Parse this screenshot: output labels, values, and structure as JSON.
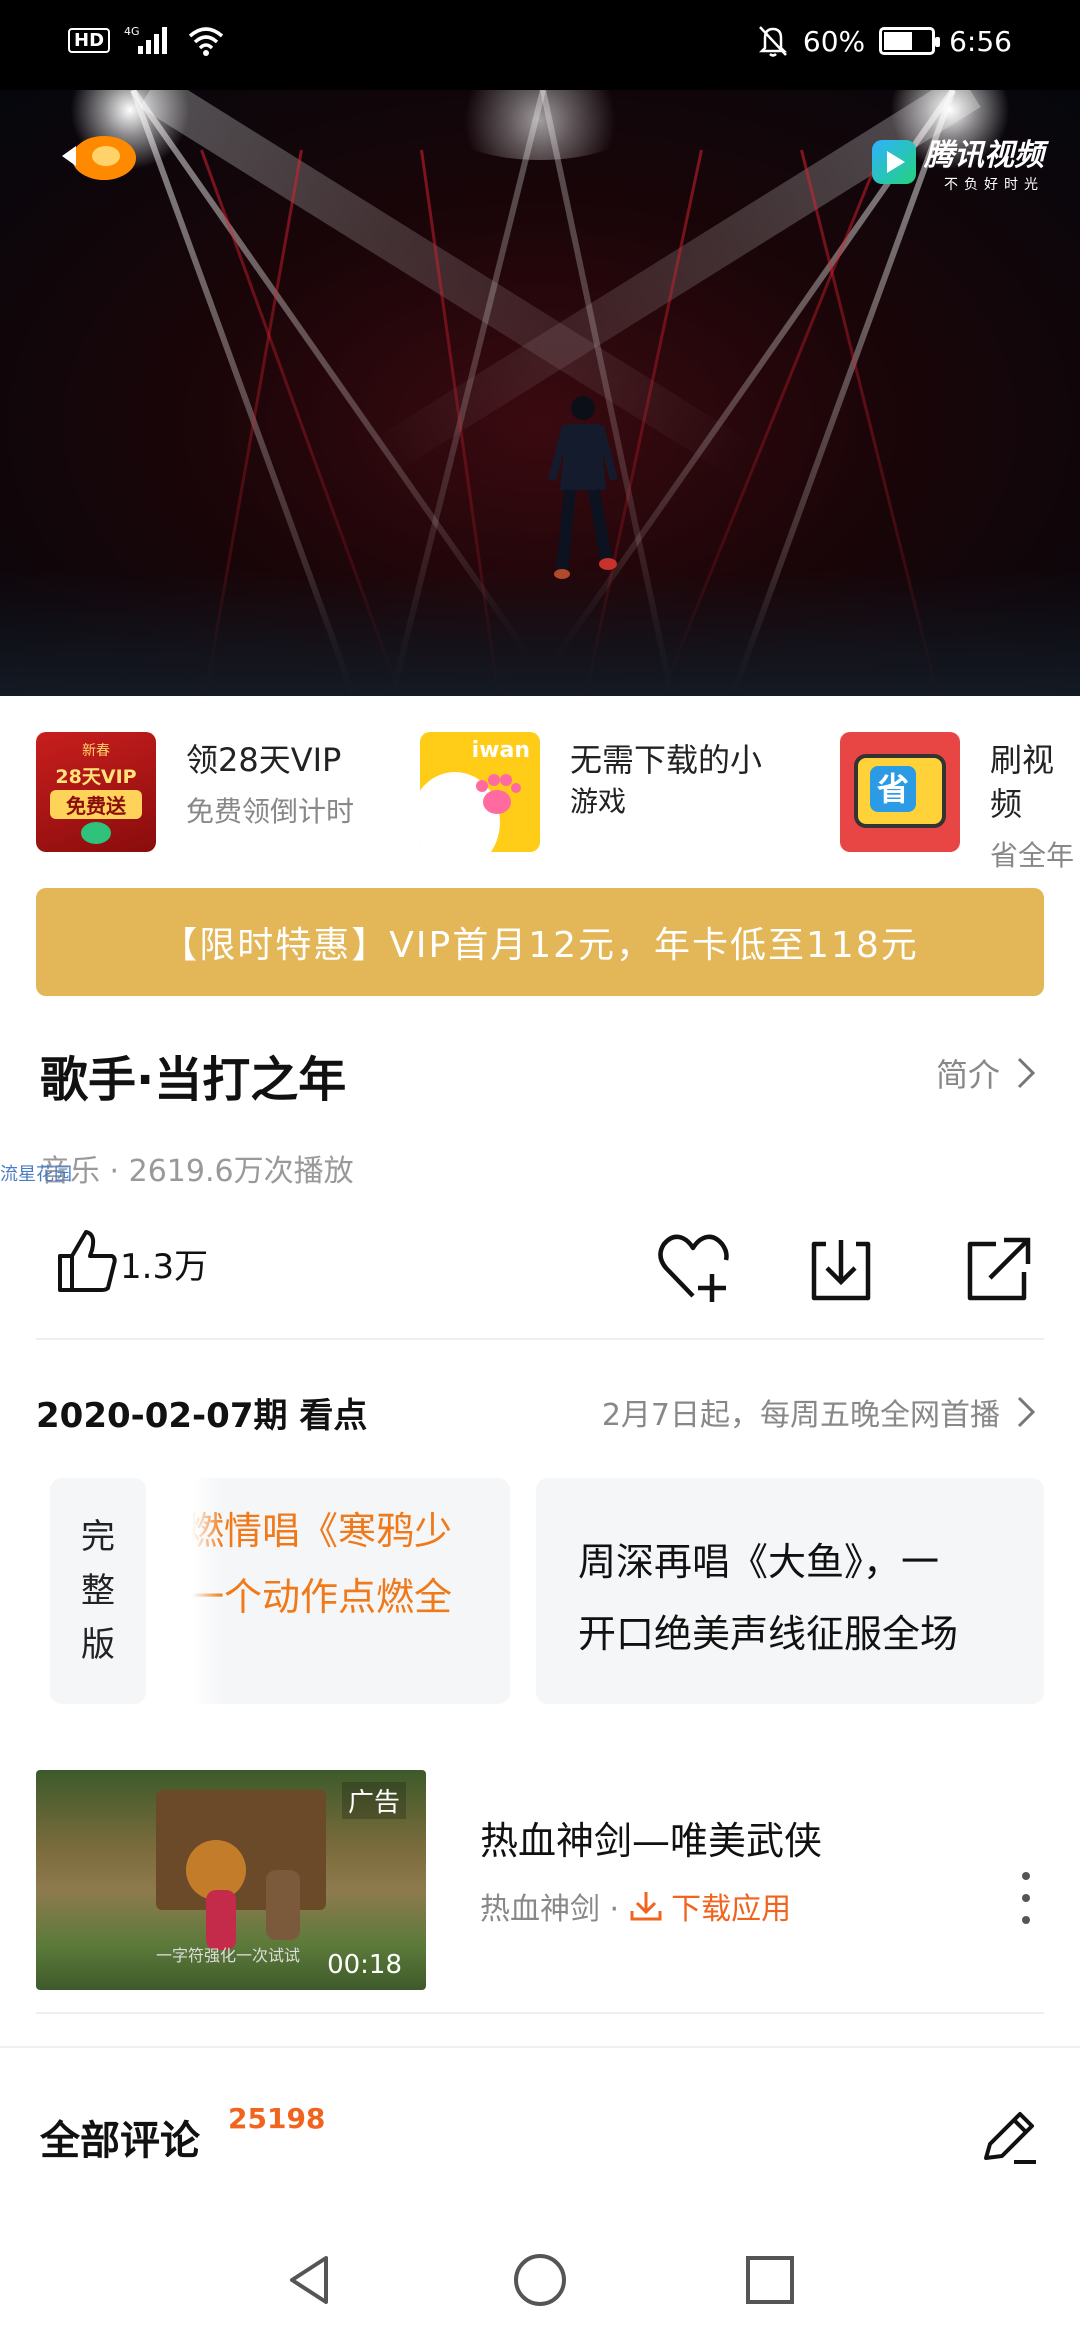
{
  "status_bar": {
    "hd_label": "HD",
    "network_label": "4G",
    "battery_text": "60%",
    "battery_level_pct": 60,
    "time": "6:56",
    "icons": [
      "signal-icon",
      "wifi-icon",
      "mute-icon",
      "battery-icon"
    ]
  },
  "video": {
    "channel_logo_icon": "mango-tv-logo",
    "platform_logo_text": "腾讯视频",
    "platform_slogan": "不负好时光"
  },
  "promos": [
    {
      "thumb_text_top": "新春",
      "thumb_text_main": "28天VIP",
      "thumb_text_bottom": "免费送",
      "title": "领28天VIP",
      "subtitle": "免费领倒计时"
    },
    {
      "thumb_text_top": "iwan",
      "title": "无需下载的小",
      "subtitle": "游戏"
    },
    {
      "thumb_text_main": "省",
      "title": "刷视频",
      "subtitle": "省全年"
    }
  ],
  "banner": {
    "text": "【限时特惠】VIP首月12元，年卡低至118元"
  },
  "show": {
    "title": "歌手·当打之年",
    "intro_label": "简介",
    "meta": "音乐 · 2619.6万次播放",
    "watermark": "流星花园"
  },
  "actions": {
    "like_count": "1.3万",
    "icons": [
      "thumbs-up-icon",
      "favorite-add-icon",
      "download-icon",
      "share-icon"
    ]
  },
  "episode": {
    "title": "2020-02-07期 看点",
    "note": "2月7日起，每周五晚全网首播",
    "full_version_label": [
      "完",
      "整",
      "版"
    ],
    "clips": [
      {
        "lines": [
          "燃情唱《寒鸦少",
          "一个动作点燃全"
        ]
      },
      {
        "lines": [
          "周深再唱《大鱼》，一",
          "开口绝美声线征服全场"
        ]
      }
    ]
  },
  "ad": {
    "badge": "广告",
    "duration": "00:18",
    "caption": "一字符强化一次试试",
    "title": "热血神剑—唯美武侠",
    "source": "热血神剑 ·",
    "download_label": "下载应用"
  },
  "comments": {
    "title": "全部评论",
    "count": "25198"
  },
  "colors": {
    "banner": "#e3b657",
    "accent_orange": "#f07a1a",
    "download_orange": "#f0641e"
  }
}
